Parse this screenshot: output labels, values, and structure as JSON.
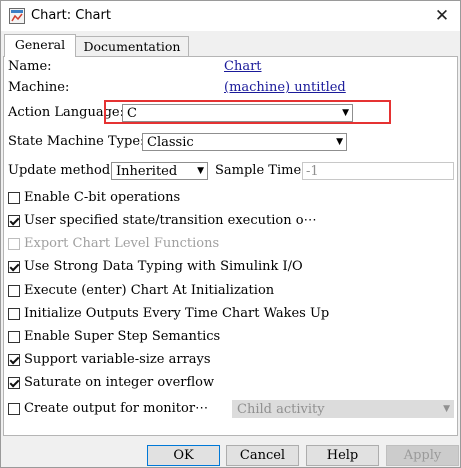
{
  "window": {
    "title": "Chart: Chart",
    "close_glyph": "✕"
  },
  "tabs": [
    {
      "label": "General",
      "active": true
    },
    {
      "label": "Documentation",
      "active": false
    }
  ],
  "general": {
    "name_label": "Name:",
    "name_value": "Chart",
    "machine_label": "Machine:",
    "machine_value": "(machine) untitled",
    "action_language_label": "Action Language:",
    "action_language_value": "C",
    "state_machine_type_label": "State Machine Type:",
    "state_machine_type_value": "Classic",
    "update_method_label": "Update method:",
    "update_method_value": "Inherited",
    "sample_time_label": "Sample Time:",
    "sample_time_value": "-1"
  },
  "options": [
    {
      "label": "Enable C-bit operations",
      "checked": false,
      "enabled": true
    },
    {
      "label": "User specified state/transition execution o⋯",
      "checked": true,
      "enabled": true
    },
    {
      "label": "Export Chart Level Functions",
      "checked": false,
      "enabled": false
    },
    {
      "label": "Use Strong Data Typing with Simulink I/O",
      "checked": true,
      "enabled": true
    },
    {
      "label": "Execute (enter) Chart At Initialization",
      "checked": false,
      "enabled": true
    },
    {
      "label": "Initialize Outputs Every Time Chart Wakes Up",
      "checked": false,
      "enabled": true
    },
    {
      "label": "Enable Super Step Semantics",
      "checked": false,
      "enabled": true
    },
    {
      "label": "Support variable-size arrays",
      "checked": true,
      "enabled": true
    },
    {
      "label": "Saturate on integer overflow",
      "checked": true,
      "enabled": true
    },
    {
      "label": "Create output for monitor⋯",
      "checked": false,
      "enabled": true
    }
  ],
  "monitor_combo_value": "Child activity",
  "buttons": {
    "ok": "OK",
    "cancel": "Cancel",
    "help": "Help",
    "apply": "Apply"
  },
  "colors": {
    "highlight": "#e53232",
    "link": "#1a1a9a",
    "default_button_border": "#0078d7"
  },
  "icons": {
    "app": "chart-app-icon",
    "close": "close-icon",
    "dropdown": "chevron-down-icon"
  }
}
